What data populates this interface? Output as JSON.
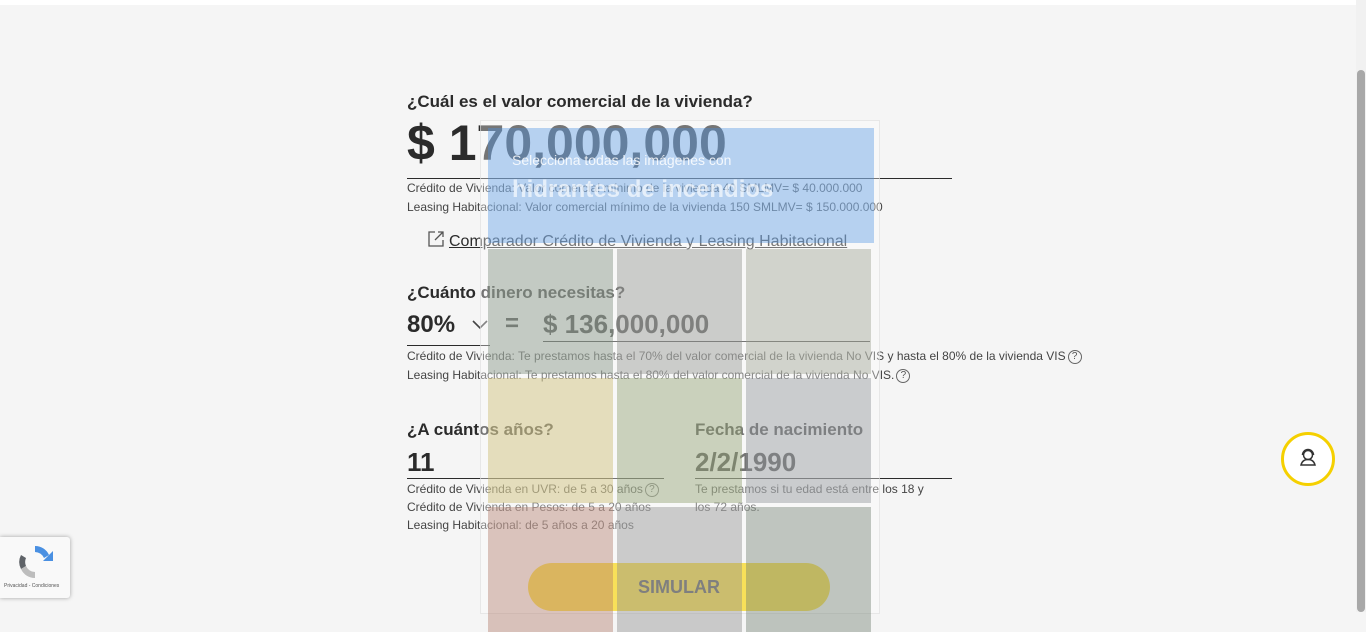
{
  "valor": {
    "question": "¿Cuál es el valor comercial de la vivienda?",
    "amount": "$ 170,000,000",
    "note_credito": "Crédito de Vivienda: Valor comercial mínimo de la vivienda 40 SMLMV= $ 40.000.000",
    "note_leasing": "Leasing Habitacional: Valor comercial mínimo de la vivienda 150 SMLMV= $ 150.000.000"
  },
  "comparador_link": "Comparador Crédito de Vivienda y Leasing Habitacional",
  "dinero": {
    "question": "¿Cuánto dinero necesitas?",
    "percent": "80%",
    "equals": "=",
    "amount": "$ 136,000,000",
    "note_credito": "Crédito de Vivienda: Te prestamos hasta el 70% del valor comercial de la vivienda No VIS y hasta el 80% de la vivienda VIS",
    "note_leasing": "Leasing Habitacional: Te prestamos hasta el 80% del valor comercial de la vivienda No VIS."
  },
  "anios": {
    "question": "¿A cuántos años?",
    "value": "11",
    "note_uvr": "Crédito de Vivienda en UVR: de 5 a 30 años",
    "note_pesos": "Crédito de Vivienda en Pesos: de 5 a 20 años",
    "note_leasing": "Leasing Habitacional: de 5 años a 20 años"
  },
  "nacimiento": {
    "label": "Fecha de nacimiento",
    "value": "2/2/1990",
    "note_line1": "Te prestamos si tu edad está entre los 18 y",
    "note_line2": "los 72 años."
  },
  "simular_label": "SIMULAR",
  "help_glyph": "?",
  "recaptcha_terms": "Privacidad - Condiciones",
  "captcha": {
    "line1": "Selecciona todas las imágenes con",
    "line2": "hidrantes de incendios"
  },
  "colors": {
    "accent": "#f5d000",
    "text": "#2b2b2b",
    "captcha_header": "#4a90e2"
  },
  "icons": [
    "external-link-icon",
    "chevron-down-icon",
    "help-circle-icon",
    "support-agent-icon",
    "recaptcha-logo-icon"
  ]
}
